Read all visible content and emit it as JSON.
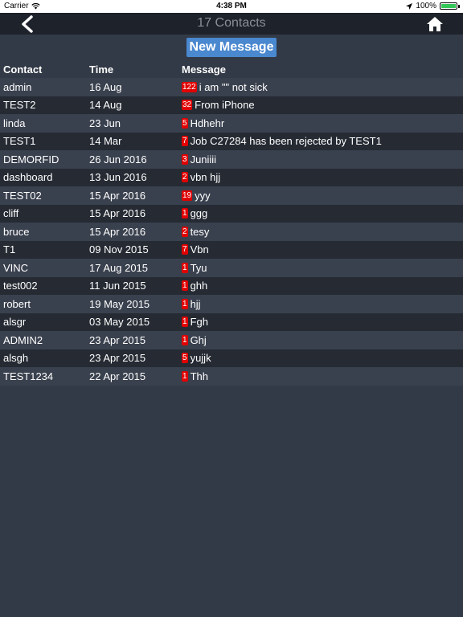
{
  "status_bar": {
    "carrier": "Carrier",
    "time": "4:38 PM",
    "battery": "100%"
  },
  "nav": {
    "title": "17 Contacts",
    "back_icon": "chevron-left-icon",
    "home_icon": "home-icon"
  },
  "new_message_label": "New Message",
  "table": {
    "headers": {
      "contact": "Contact",
      "time": "Time",
      "message": "Message"
    },
    "rows": [
      {
        "contact": "admin",
        "time": "16 Aug",
        "count": "122",
        "message": "i am \"\" not sick"
      },
      {
        "contact": "TEST2",
        "time": "14 Aug",
        "count": "32",
        "message": "From iPhone"
      },
      {
        "contact": "linda",
        "time": "23 Jun",
        "count": "5",
        "message": "Hdhehr"
      },
      {
        "contact": "TEST1",
        "time": "14 Mar",
        "count": "7",
        "message": "Job C27284 has been rejected by TEST1"
      },
      {
        "contact": "DEMORFID",
        "time": "26 Jun 2016",
        "count": "3",
        "message": "Juniiii"
      },
      {
        "contact": "dashboard",
        "time": "13 Jun 2016",
        "count": "2",
        "message": "vbn hjj"
      },
      {
        "contact": "TEST02",
        "time": "15 Apr 2016",
        "count": "19",
        "message": "yyy"
      },
      {
        "contact": "cliff",
        "time": "15 Apr 2016",
        "count": "1",
        "message": "ggg"
      },
      {
        "contact": "bruce",
        "time": "15 Apr 2016",
        "count": "2",
        "message": "tesy"
      },
      {
        "contact": "T1",
        "time": "09 Nov 2015",
        "count": "7",
        "message": "Vbn"
      },
      {
        "contact": "VINC",
        "time": "17 Aug 2015",
        "count": "1",
        "message": "Tyu"
      },
      {
        "contact": "test002",
        "time": "11 Jun 2015",
        "count": "1",
        "message": "ghh"
      },
      {
        "contact": "robert",
        "time": "19 May 2015",
        "count": "1",
        "message": "hjj"
      },
      {
        "contact": "alsgr",
        "time": "03 May 2015",
        "count": "1",
        "message": "Fgh"
      },
      {
        "contact": "ADMIN2",
        "time": "23 Apr 2015",
        "count": "1",
        "message": "Ghj"
      },
      {
        "contact": "alsgh",
        "time": "23 Apr 2015",
        "count": "5",
        "message": "yujjk"
      },
      {
        "contact": "TEST1234",
        "time": "22 Apr 2015",
        "count": "1",
        "message": "Thh"
      }
    ]
  },
  "colors": {
    "background": "#333a47",
    "nav_background": "#1e222a",
    "button_blue": "#4a88cf",
    "badge_red": "#e00000",
    "row_light": "#3a414e",
    "row_dark": "#252a33"
  }
}
